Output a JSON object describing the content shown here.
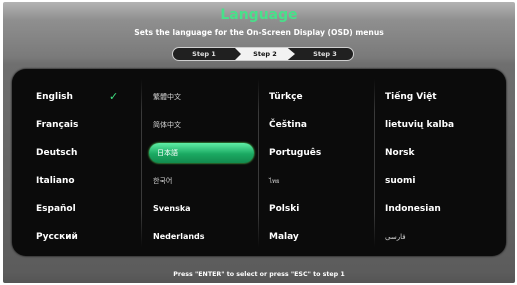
{
  "header": {
    "title": "Language",
    "subtitle": "Sets the language for the On-Screen Display (OSD) menus"
  },
  "steps": {
    "items": [
      "Step 1",
      "Step 2",
      "Step 3"
    ],
    "current": "Step 2"
  },
  "languages": {
    "columns": [
      [
        "English",
        "Français",
        "Deutsch",
        "Italiano",
        "Español",
        "Русский"
      ],
      [
        "繁體中文",
        "简体中文",
        "日本語",
        "한국어",
        "Svenska",
        "Nederlands"
      ],
      [
        "Türkçe",
        "Čeština",
        "Português",
        "ไทย",
        "Polski",
        "Malay"
      ],
      [
        "Tiếng Việt",
        "lietuvių kalba",
        "Norsk",
        "suomi",
        "Indonesian",
        "فارسی"
      ]
    ],
    "checked": "English",
    "highlighted": "日本語"
  },
  "icons": {
    "check": "check-icon"
  },
  "colors": {
    "accent": "#48e08a",
    "highlight": "#1ba962",
    "panel": "#0b0b0b"
  },
  "footer": {
    "hint": "Press \"ENTER\" to select or press \"ESC\" to step 1"
  }
}
